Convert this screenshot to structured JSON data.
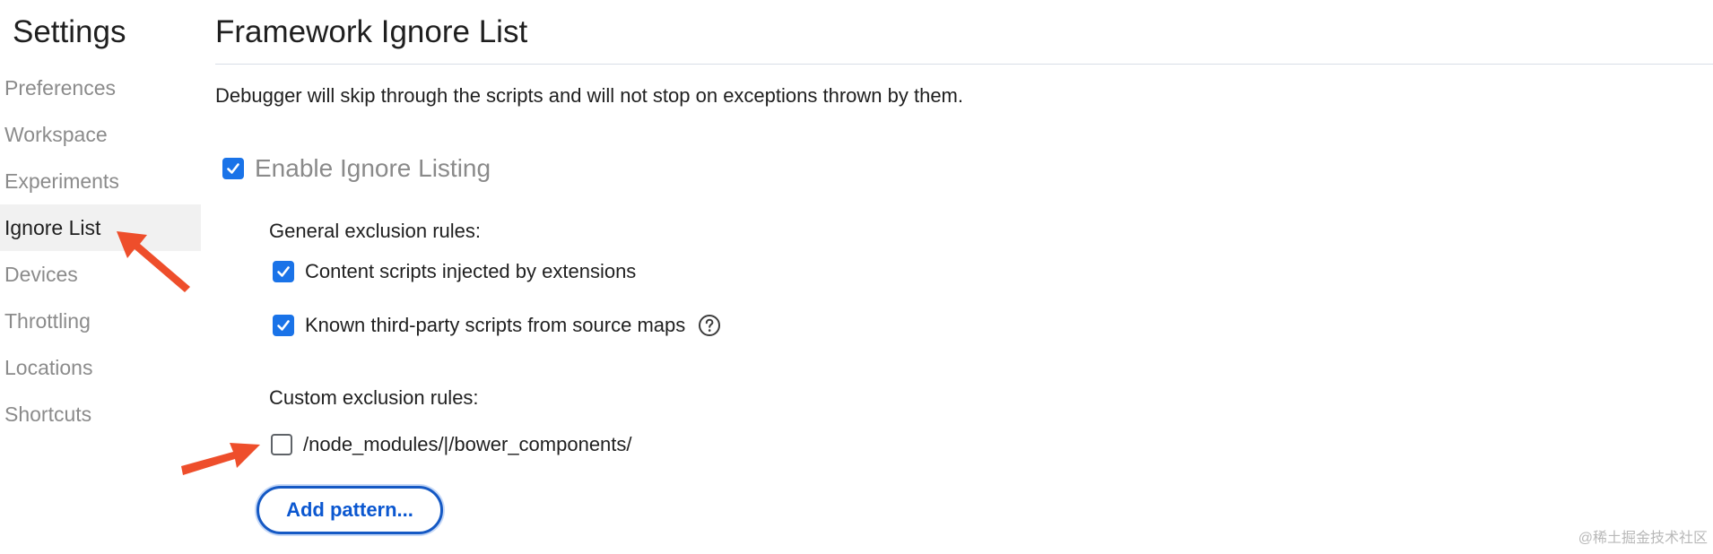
{
  "sidebar": {
    "title": "Settings",
    "items": [
      {
        "label": "Preferences",
        "selected": false
      },
      {
        "label": "Workspace",
        "selected": false
      },
      {
        "label": "Experiments",
        "selected": false
      },
      {
        "label": "Ignore List",
        "selected": true
      },
      {
        "label": "Devices",
        "selected": false
      },
      {
        "label": "Throttling",
        "selected": false
      },
      {
        "label": "Locations",
        "selected": false
      },
      {
        "label": "Shortcuts",
        "selected": false
      }
    ]
  },
  "main": {
    "title": "Framework Ignore List",
    "description": "Debugger will skip through the scripts and will not stop on exceptions thrown by them.",
    "enable_ignore_listing": {
      "label": "Enable Ignore Listing",
      "checked": true
    },
    "general_rules": {
      "label": "General exclusion rules:",
      "content_scripts": {
        "label": "Content scripts injected by extensions",
        "checked": true
      },
      "third_party": {
        "label": "Known third-party scripts from source maps",
        "checked": true,
        "help_icon": "help-circle-icon"
      }
    },
    "custom_rules": {
      "label": "Custom exclusion rules:",
      "patterns": [
        {
          "text_before_cursor": "/node_modules/|",
          "text_after_cursor": "/bower_components/",
          "checked": false
        }
      ]
    },
    "add_pattern_label": "Add pattern..."
  },
  "watermark": "@稀土掘金技术社区",
  "colors": {
    "accent": "#1a73e8",
    "annotation_arrow": "#ee4e2b",
    "selected_bg": "#f1f1f1",
    "muted_text": "#8b8b8b"
  }
}
